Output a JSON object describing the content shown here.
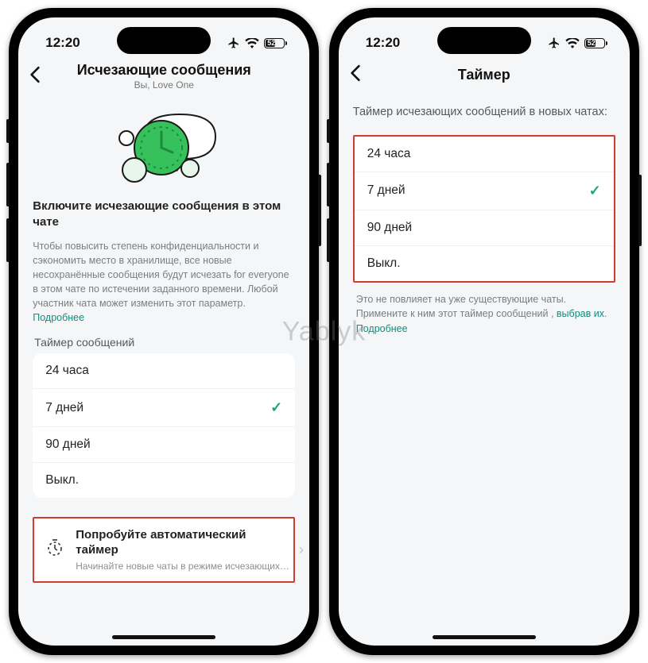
{
  "watermark": "Yablyk",
  "status": {
    "time": "12:20",
    "battery": "52"
  },
  "left": {
    "nav": {
      "title": "Исчезающие сообщения",
      "subtitle": "Вы, Love One"
    },
    "lead": "Включите исчезающие сообщения в этом чате",
    "desc_pre": "Чтобы повысить степень конфиденциальности и сэкономить место в хранилище, все новые несохранённые сообщения будут исчезать for everyone в этом чате по истечении заданного времени. Любой участник чата может изменить этот параметр. ",
    "desc_link": "Подробнее",
    "section_label": "Таймер сообщений",
    "options": [
      {
        "label": "24 часа",
        "selected": false
      },
      {
        "label": "7 дней",
        "selected": true
      },
      {
        "label": "90 дней",
        "selected": false
      },
      {
        "label": "Выкл.",
        "selected": false
      }
    ],
    "auto": {
      "title": "Попробуйте автоматический таймер",
      "subtitle": "Начинайте новые чаты в режиме исчезающих…"
    }
  },
  "right": {
    "nav": {
      "title": "Таймер"
    },
    "lead": "Таймер исчезающих сообщений в новых чатах:",
    "options": [
      {
        "label": "24 часа",
        "selected": false
      },
      {
        "label": "7 дней",
        "selected": true
      },
      {
        "label": "90 дней",
        "selected": false
      },
      {
        "label": "Выкл.",
        "selected": false
      }
    ],
    "note_pre": "Это не повлияет на уже существующие чаты. Примените к ним этот таймер сообщений , ",
    "note_link1": "выбрав их",
    "note_mid": ". ",
    "note_link2": "Подробнее"
  }
}
